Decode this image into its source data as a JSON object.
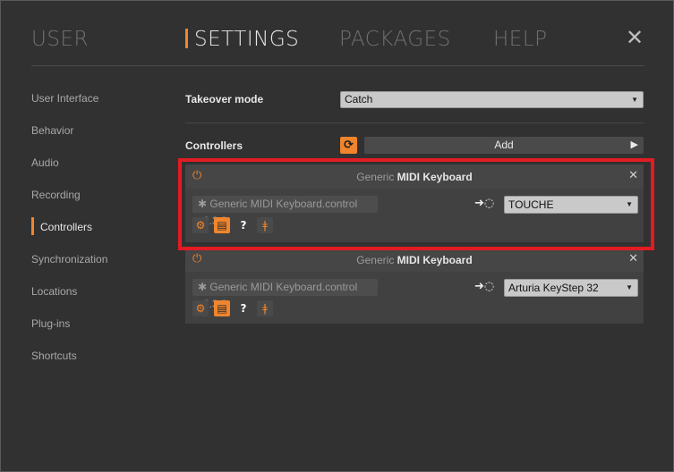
{
  "tabs": [
    {
      "label": "USER",
      "active": false
    },
    {
      "label": "SETTINGS",
      "active": true
    },
    {
      "label": "PACKAGES",
      "active": false
    },
    {
      "label": "HELP",
      "active": false
    }
  ],
  "close_icon": "close-icon",
  "accent_color": "#f0852d",
  "highlight_color": "#e31b23",
  "sidebar": {
    "items": [
      {
        "label": "User Interface"
      },
      {
        "label": "Behavior"
      },
      {
        "label": "Audio"
      },
      {
        "label": "Recording"
      },
      {
        "label": "Controllers",
        "active": true
      },
      {
        "label": "Synchronization"
      },
      {
        "label": "Locations"
      },
      {
        "label": "Plug-ins"
      },
      {
        "label": "Shortcuts"
      }
    ]
  },
  "takeover": {
    "label": "Takeover mode",
    "value": "Catch"
  },
  "controllers": {
    "label": "Controllers",
    "add_label": "Add"
  },
  "cards": [
    {
      "vendor": "Generic",
      "name": "MIDI Keyboard",
      "script": "Generic MIDI Keyboard.control v2.3.3",
      "port": "TOUCHE"
    },
    {
      "vendor": "Generic",
      "name": "MIDI Keyboard",
      "script": "Generic MIDI Keyboard.control v2.3.3",
      "port": "Arturia KeyStep 32"
    }
  ]
}
